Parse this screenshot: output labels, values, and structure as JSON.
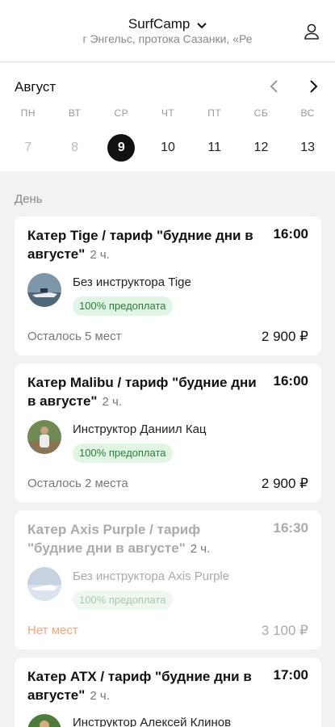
{
  "header": {
    "title": "SurfCamp",
    "address": "г Энгельс, протока Сазанки, «Ре",
    "title_icon": "chevron-down-icon",
    "user_icon": "user-icon"
  },
  "calendar": {
    "month": "Август",
    "weekdays": [
      "ПН",
      "ВТ",
      "СР",
      "ЧТ",
      "ПТ",
      "СБ",
      "ВС"
    ],
    "days": [
      "7",
      "8",
      "9",
      "10",
      "11",
      "12",
      "13"
    ],
    "selected_index": 2
  },
  "section": {
    "label": "День"
  },
  "slots": [
    {
      "title": "Катер Tige / тариф \"будние дни в августе\"",
      "duration": "2 ч.",
      "time": "16:00",
      "instructor": "Без инструктора Tige",
      "badge": "100% предоплата",
      "availability": "Осталось 5 мест",
      "price": "2 900 ₽"
    },
    {
      "title": "Катер Malibu / тариф \"будние дни в августе\"",
      "duration": "2 ч.",
      "time": "16:00",
      "instructor": "Инструктор Даниил Кац",
      "badge": "100% предоплата",
      "availability": "Осталось 2 места",
      "price": "2 900 ₽"
    },
    {
      "title": "Катер Axis Purple / тариф \"будние дни в августе\"",
      "duration": "2 ч.",
      "time": "16:30",
      "instructor": "Без инструктора Axis Purple",
      "badge": "100% предоплата",
      "availability": "Нет мест",
      "price": "3 100 ₽"
    },
    {
      "title": "Катер ATX / тариф \"будние дни в августе\"",
      "duration": "2 ч.",
      "time": "17:00",
      "instructor": "Инструктор Алексей Клинов"
    }
  ]
}
